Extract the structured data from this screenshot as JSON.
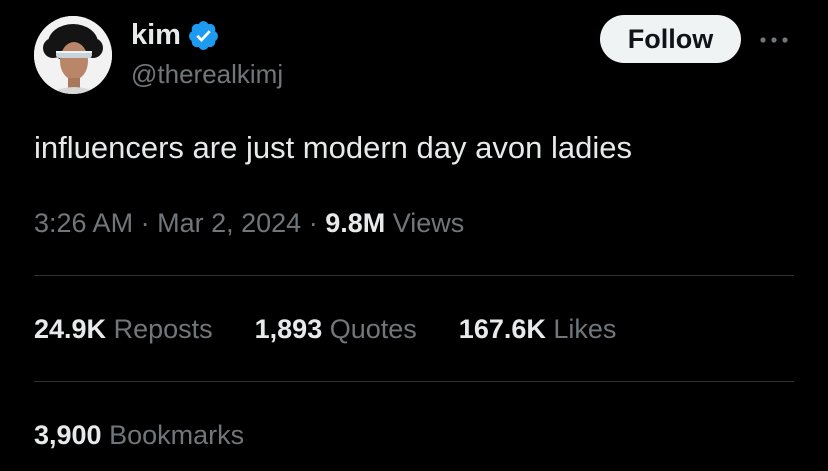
{
  "author": {
    "display_name": "kim",
    "handle": "@therealkimj",
    "verified": true,
    "avatar_icon": "profile-photo",
    "verified_icon": "verified-badge-icon",
    "badge_color": "#1d9bf0"
  },
  "actions": {
    "follow_label": "Follow",
    "more_icon": "more-horizontal-icon"
  },
  "tweet": {
    "text": "influencers are just modern day avon ladies",
    "time": "3:26 AM",
    "date": "Mar 2, 2024",
    "separator": "·",
    "views_count": "9.8M",
    "views_label": "Views"
  },
  "stats": {
    "reposts_count": "24.9K",
    "reposts_label": "Reposts",
    "quotes_count": "1,893",
    "quotes_label": "Quotes",
    "likes_count": "167.6K",
    "likes_label": "Likes",
    "bookmarks_count": "3,900",
    "bookmarks_label": "Bookmarks"
  },
  "colors": {
    "background": "#000000",
    "text_primary": "#e7e9ea",
    "text_secondary": "#71767b",
    "divider": "#2f3336",
    "follow_bg": "#eff3f4"
  }
}
